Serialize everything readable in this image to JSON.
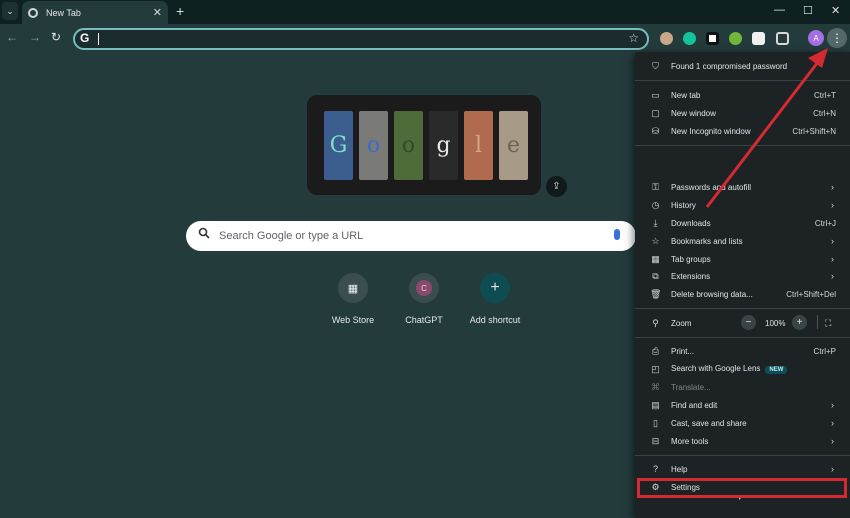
{
  "tab": {
    "title": "New Tab",
    "close": "✕",
    "new_tab": "+"
  },
  "window_controls": {
    "minimize": "—",
    "maximize": "☐",
    "close": "✕"
  },
  "toolbar": {
    "back": "←",
    "forward": "→",
    "reload": "↻",
    "omnibox_g": "G",
    "star": "☆",
    "profile_letter": "A",
    "menu": "⋮"
  },
  "doodle": {
    "letters": [
      "G",
      "o",
      "o",
      "g",
      "l",
      "e"
    ],
    "tile_colors": [
      "#3c5e8e",
      "#7a7a78",
      "#4e6b3a",
      "#2a2a2a",
      "#b06a4e",
      "#a89a86"
    ],
    "letter_colors": [
      "#7fe0c9",
      "#3d6cc8",
      "#2f4a2a",
      "#e8e8e8",
      "#d2a68e",
      "#6c6258"
    ],
    "share": "⇪"
  },
  "search": {
    "icon": "🔍",
    "placeholder": "Search Google or type a URL"
  },
  "shortcuts": [
    {
      "label": "Web Store",
      "glyph": "▦",
      "color": "#f2f2f2"
    },
    {
      "label": "ChatGPT",
      "glyph": "C",
      "color": "#ffffff"
    },
    {
      "label": "Add shortcut",
      "glyph": "+",
      "color": "#ffffff"
    }
  ],
  "menu": {
    "password_warning": "Found 1 compromised password",
    "new_tab": {
      "label": "New tab",
      "shortcut": "Ctrl+T"
    },
    "new_window": {
      "label": "New window",
      "shortcut": "Ctrl+N"
    },
    "incognito": {
      "label": "New Incognito window",
      "shortcut": "Ctrl+Shift+N"
    },
    "passwords": "Passwords and autofill",
    "history": "History",
    "downloads": {
      "label": "Downloads",
      "shortcut": "Ctrl+J"
    },
    "bookmarks": "Bookmarks and lists",
    "tab_groups": "Tab groups",
    "extensions": "Extensions",
    "clear_data": {
      "label": "Delete browsing data...",
      "shortcut": "Ctrl+Shift+Del"
    },
    "zoom": {
      "label": "Zoom",
      "minus": "−",
      "value": "100%",
      "plus": "+",
      "fullscreen": "⛶"
    },
    "print": {
      "label": "Print...",
      "shortcut": "Ctrl+P"
    },
    "lens": {
      "label": "Search with Google Lens",
      "badge": "NEW"
    },
    "translate": "Translate...",
    "find_edit": "Find and edit",
    "cast": "Cast, save and share",
    "more_tools": "More tools",
    "help": "Help",
    "settings": "Settings",
    "chevron": "›",
    "more_indicator": "▾"
  },
  "annotation_color": "#d42a33"
}
